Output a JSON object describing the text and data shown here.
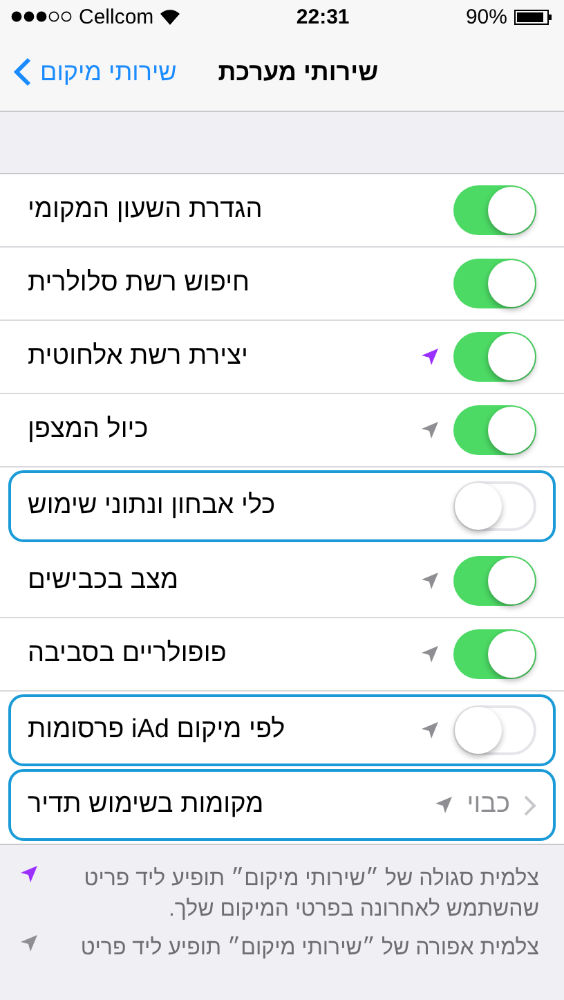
{
  "status_bar": {
    "carrier": "Cellcom",
    "time": "22:31",
    "battery": "90%"
  },
  "nav": {
    "back": "שירותי מיקום",
    "title": "שירותי מערכת"
  },
  "rows": [
    {
      "kind": "toggle",
      "label": "הגדרת השעון המקומי",
      "on": true,
      "highlighted": false
    },
    {
      "kind": "toggle",
      "label": "חיפוש רשת סלולרית",
      "on": true,
      "highlighted": false
    },
    {
      "kind": "toggle",
      "label": "יצירת רשת אלחוטית",
      "on": true,
      "highlighted": false,
      "color": "#9b30ff"
    },
    {
      "kind": "toggle",
      "label": "כיול המצפן",
      "on": true,
      "highlighted": false,
      "color": "#8e8e93"
    },
    {
      "kind": "toggle",
      "label": "כלי אבחון ונתוני שימוש",
      "on": false,
      "highlighted": true
    },
    {
      "kind": "toggle",
      "label": "מצב בכבישים",
      "on": true,
      "highlighted": false,
      "color": "#8e8e93"
    },
    {
      "kind": "toggle",
      "label": "פופולריים בסביבה",
      "on": true,
      "highlighted": false,
      "color": "#8e8e93"
    },
    {
      "kind": "toggle",
      "label": "פרסומות iAd לפי מיקום",
      "on": false,
      "highlighted": true,
      "color": "#8e8e93"
    },
    {
      "kind": "link",
      "label": "מקומות בשימוש תדיר",
      "value": "כבוי",
      "highlighted": true,
      "color": "#8e8e93"
    }
  ],
  "notes": [
    {
      "color": "#9b30ff",
      "text": "צלמית סגולה של ״שירותי מיקום״ תופיע ליד פריט שהשתמש לאחרונה בפרטי המיקום שלך."
    },
    {
      "color": "#8e8e93",
      "text": "צלמית אפורה של ״שירותי מיקום״ תופיע ליד פריט"
    }
  ]
}
